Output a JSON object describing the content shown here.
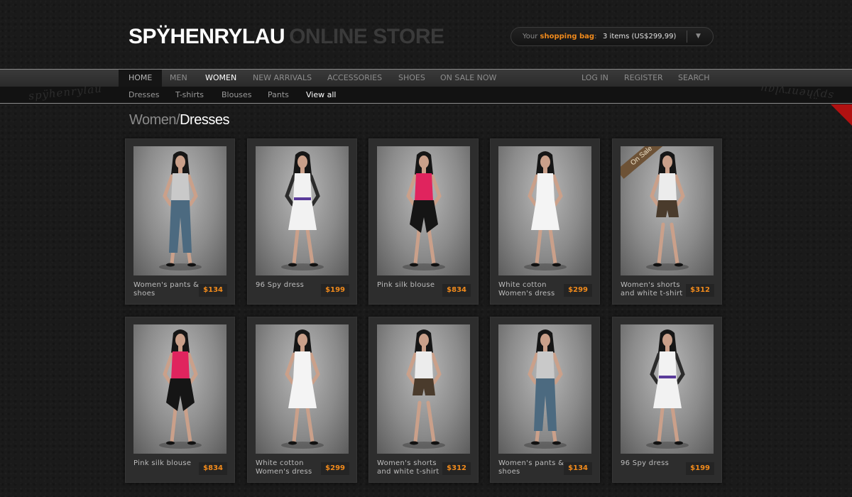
{
  "header": {
    "logo_main": "SPŸHENRYLAU",
    "logo_sub": "ONLINE STORE"
  },
  "bag": {
    "prefix": "Your",
    "link_label": "shopping bag",
    "colon": ":",
    "items": "3 items (US$299,99)",
    "accent_color": "#f08a1c"
  },
  "nav": {
    "main": [
      "HOME",
      "MEN",
      "WOMEN",
      "NEW ARRIVALS",
      "ACCESSORIES",
      "SHOES",
      "ON SALE NOW"
    ],
    "account": [
      "LOG IN",
      "REGISTER",
      "SEARCH"
    ],
    "sub": [
      "Dresses",
      "T-shirts",
      "Blouses",
      "Pants",
      "View all"
    ]
  },
  "watermark": "spÿhenrylau",
  "breadcrumb": {
    "parent": "Women",
    "separator": "/",
    "current": "Dresses"
  },
  "products": [
    {
      "name": "Women's pants & shoes",
      "price": "$134",
      "outfit": "denim"
    },
    {
      "name": "96 Spy dress",
      "price": "$199",
      "outfit": "spy"
    },
    {
      "name": "Pink silk blouse",
      "price": "$834",
      "outfit": "pink"
    },
    {
      "name": "White cotton Women's dress",
      "price": "$299",
      "outfit": "white"
    },
    {
      "name": "Women's shorts and white t-shirt",
      "price": "$312",
      "outfit": "shorts",
      "badge": "On Sale"
    },
    {
      "name": "Pink silk blouse",
      "price": "$834",
      "outfit": "pink"
    },
    {
      "name": "White cotton Women's dress",
      "price": "$299",
      "outfit": "white"
    },
    {
      "name": "Women's shorts and white t-shirt",
      "price": "$312",
      "outfit": "shorts"
    },
    {
      "name": "Women's pants & shoes",
      "price": "$134",
      "outfit": "denim"
    },
    {
      "name": "96 Spy dress",
      "price": "$199",
      "outfit": "spy"
    }
  ]
}
